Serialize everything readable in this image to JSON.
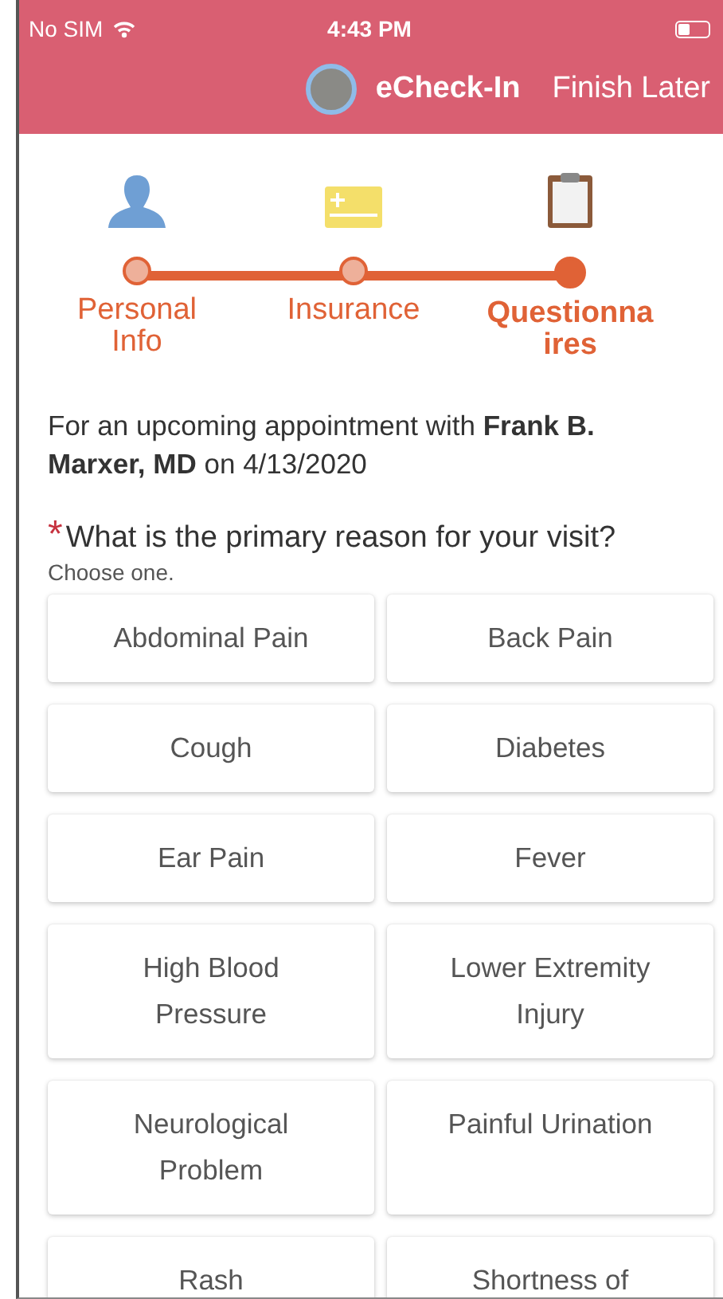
{
  "status_bar": {
    "carrier": "No SIM",
    "time": "4:43 PM"
  },
  "nav": {
    "title": "eCheck-In",
    "action": "Finish Later"
  },
  "steps": [
    {
      "label": "Personal Info",
      "kind": "person",
      "selected": false
    },
    {
      "label": "Insurance",
      "kind": "card",
      "selected": false
    },
    {
      "label": "Questionna ires",
      "kind": "clipboard",
      "selected": true
    }
  ],
  "intro": "For an upcoming appointment with **Frank B. Marxer, MD** on 4/13/2020",
  "question": {
    "marker": "*",
    "text": "What is the primary reason for your visit?",
    "hint": "Choose one."
  },
  "options": [
    {
      "label": "Abdominal Pain",
      "selected": false
    },
    {
      "label": "Back Pain",
      "selected": false
    },
    {
      "label": "Cough",
      "selected": false
    },
    {
      "label": "Diabetes",
      "selected": false
    },
    {
      "label": "Ear Pain",
      "selected": false
    },
    {
      "label": "Fever",
      "selected": false
    },
    {
      "label": "High Blood Pressure",
      "selected": false
    },
    {
      "label": "Lower Extremity Injury",
      "selected": false
    },
    {
      "label": "Neurological Problem",
      "selected": false
    },
    {
      "label": "Painful Urination",
      "selected": false
    },
    {
      "label": "Rash",
      "selected": false
    },
    {
      "label": "Shortness of",
      "selected": false
    }
  ]
}
